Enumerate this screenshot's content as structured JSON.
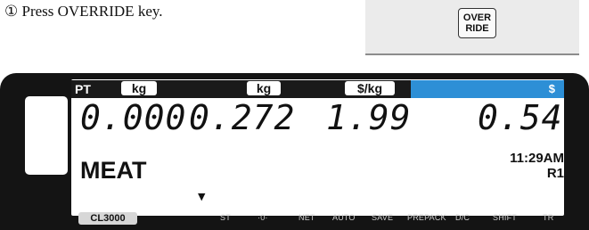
{
  "instruction": "① Press OVERRIDE key.",
  "key": {
    "line1": "OVER",
    "line2": "RIDE"
  },
  "display": {
    "labels": {
      "pt": "PT",
      "kg1": "kg",
      "kg2": "kg",
      "per_kg": "$/kg",
      "dollar": "$"
    },
    "tare": "0.000",
    "weight": "0.272",
    "unit_price": "1.99",
    "total": "0.54",
    "product": "MEAT",
    "time": "11:29AM",
    "register": "R1",
    "arrow": "▼"
  },
  "indicators": {
    "model": "CL3000",
    "items": [
      "ST",
      "·0·",
      "NET",
      "AUTO",
      "SAVE",
      "PREPACK",
      "D/C",
      "SHIFT",
      "TR"
    ]
  },
  "colors": {
    "accent": "#2d8fd6",
    "panel": "#141414",
    "lcd": "#ffffff"
  }
}
